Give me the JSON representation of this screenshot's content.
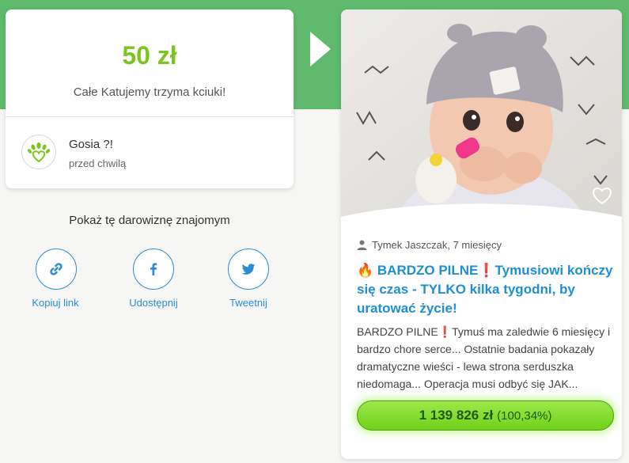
{
  "donation": {
    "amount": "50 zł",
    "message": "Całe Katujemy trzyma kciuki!",
    "donor_name": "Gosia ?!",
    "time": "przed chwilą"
  },
  "share": {
    "title": "Pokaż tę darowiznę znajomym",
    "buttons": [
      {
        "label": "Kopiuj link",
        "icon": "link-icon"
      },
      {
        "label": "Udostępnij",
        "icon": "facebook-icon"
      },
      {
        "label": "Tweetnij",
        "icon": "twitter-icon"
      }
    ]
  },
  "campaign": {
    "author": "Tymek Jaszczak, 7 miesięcy",
    "title": "🔥 BARDZO PILNE❗Tymusiowi kończy się czas - TYLKO kilka tygodni, by uratować życie!",
    "description": "BARDZO PILNE❗Tymuś ma zaledwie 6 miesięcy i bardzo chore serce... Ostatnie badania pokazały dramatyczne wieści - lewa strona serduszka niedomaga... Operacja musi odbyć się JAK...",
    "raised": "1 139 826 zł",
    "percent": "(100,34%)",
    "progress_fraction": 1.0034
  },
  "colors": {
    "brand_green": "#5fba6d",
    "amount_green": "#7cc520",
    "link_blue": "#2a8dd6"
  }
}
